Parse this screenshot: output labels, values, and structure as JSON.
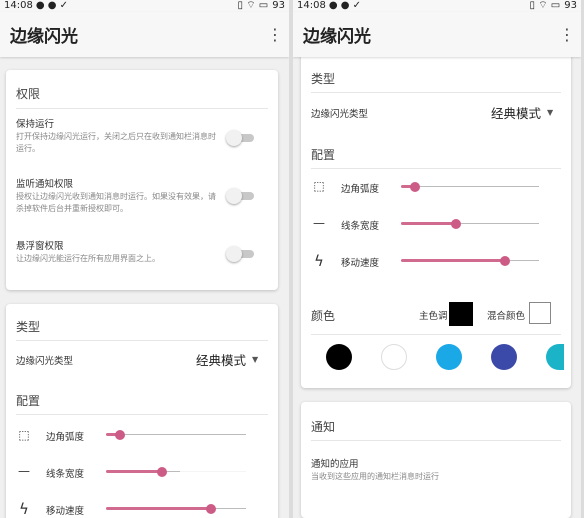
{
  "status": {
    "time": "14:08",
    "battery": "93"
  },
  "app": {
    "title": "边缘闪光",
    "menu_icon": "more-vert-icon"
  },
  "permissions": {
    "title": "权限",
    "items": [
      {
        "label": "保持运行",
        "desc": "打开保持边缘闪光运行，关闭之后只在收到通知栏消息时运行。",
        "on": false
      },
      {
        "label": "监听通知权限",
        "desc": "授权让边缘闪光收到通知消息时运行。如果没有效果，请杀掉软件后台并重新授权即可。",
        "on": false
      },
      {
        "label": "悬浮窗权限",
        "desc": "让边缘闪光能运行在所有应用界面之上。",
        "on": false
      }
    ]
  },
  "type": {
    "title": "类型",
    "label": "边缘闪光类型",
    "value": "经典模式"
  },
  "config": {
    "title": "配置",
    "sliders": [
      {
        "label": "边角弧度",
        "icon": "rounded-corner-icon",
        "value": 0.1
      },
      {
        "label": "线条宽度",
        "icon": "line-width-icon",
        "value": 0.4
      },
      {
        "label": "移动速度",
        "icon": "flash-icon",
        "value": 0.75
      }
    ]
  },
  "color": {
    "title": "颜色",
    "primary_label": "主色调",
    "mixed_label": "混合颜色",
    "primary_color": "#000000",
    "palette": [
      "#000000",
      "#ffffff",
      "#1aa8e6",
      "#3b4aa8",
      "#1bb3c7"
    ]
  },
  "notify": {
    "title": "通知",
    "label": "通知的应用",
    "desc": "当收到这些应用的通知栏消息时运行"
  },
  "accent": "#d16a8f"
}
